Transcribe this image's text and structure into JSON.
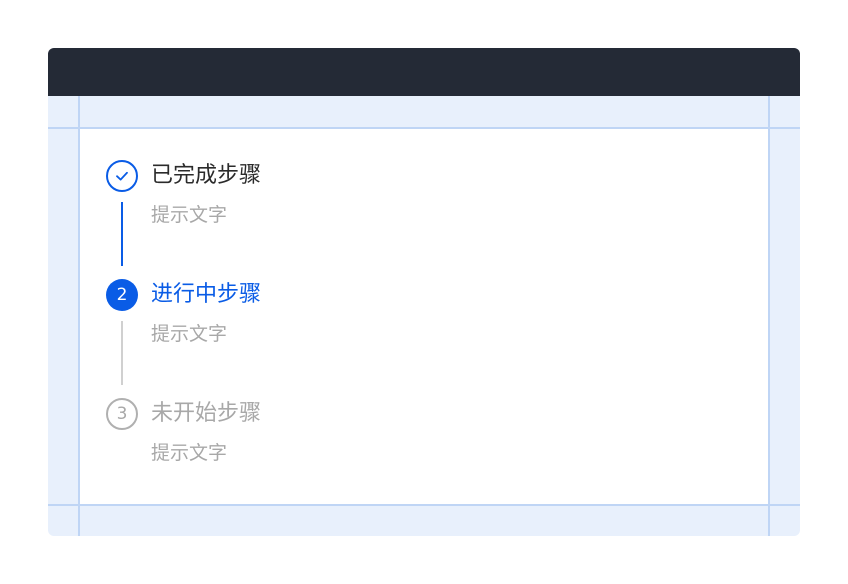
{
  "colors": {
    "titlebar": "#242a36",
    "guide": "#bfd5f5",
    "guide_area": "#e8f0fc",
    "primary": "#0a5ce6",
    "text_primary": "#2b2b2b",
    "text_secondary": "#a8a8a8",
    "connector_pending": "#d0d0d0"
  },
  "steps": [
    {
      "status": "finished",
      "icon": "check-icon",
      "title": "已完成步骤",
      "description": "提示文字"
    },
    {
      "status": "process",
      "number": "2",
      "title": "进行中步骤",
      "description": "提示文字"
    },
    {
      "status": "wait",
      "number": "3",
      "title": "未开始步骤",
      "description": "提示文字"
    }
  ]
}
